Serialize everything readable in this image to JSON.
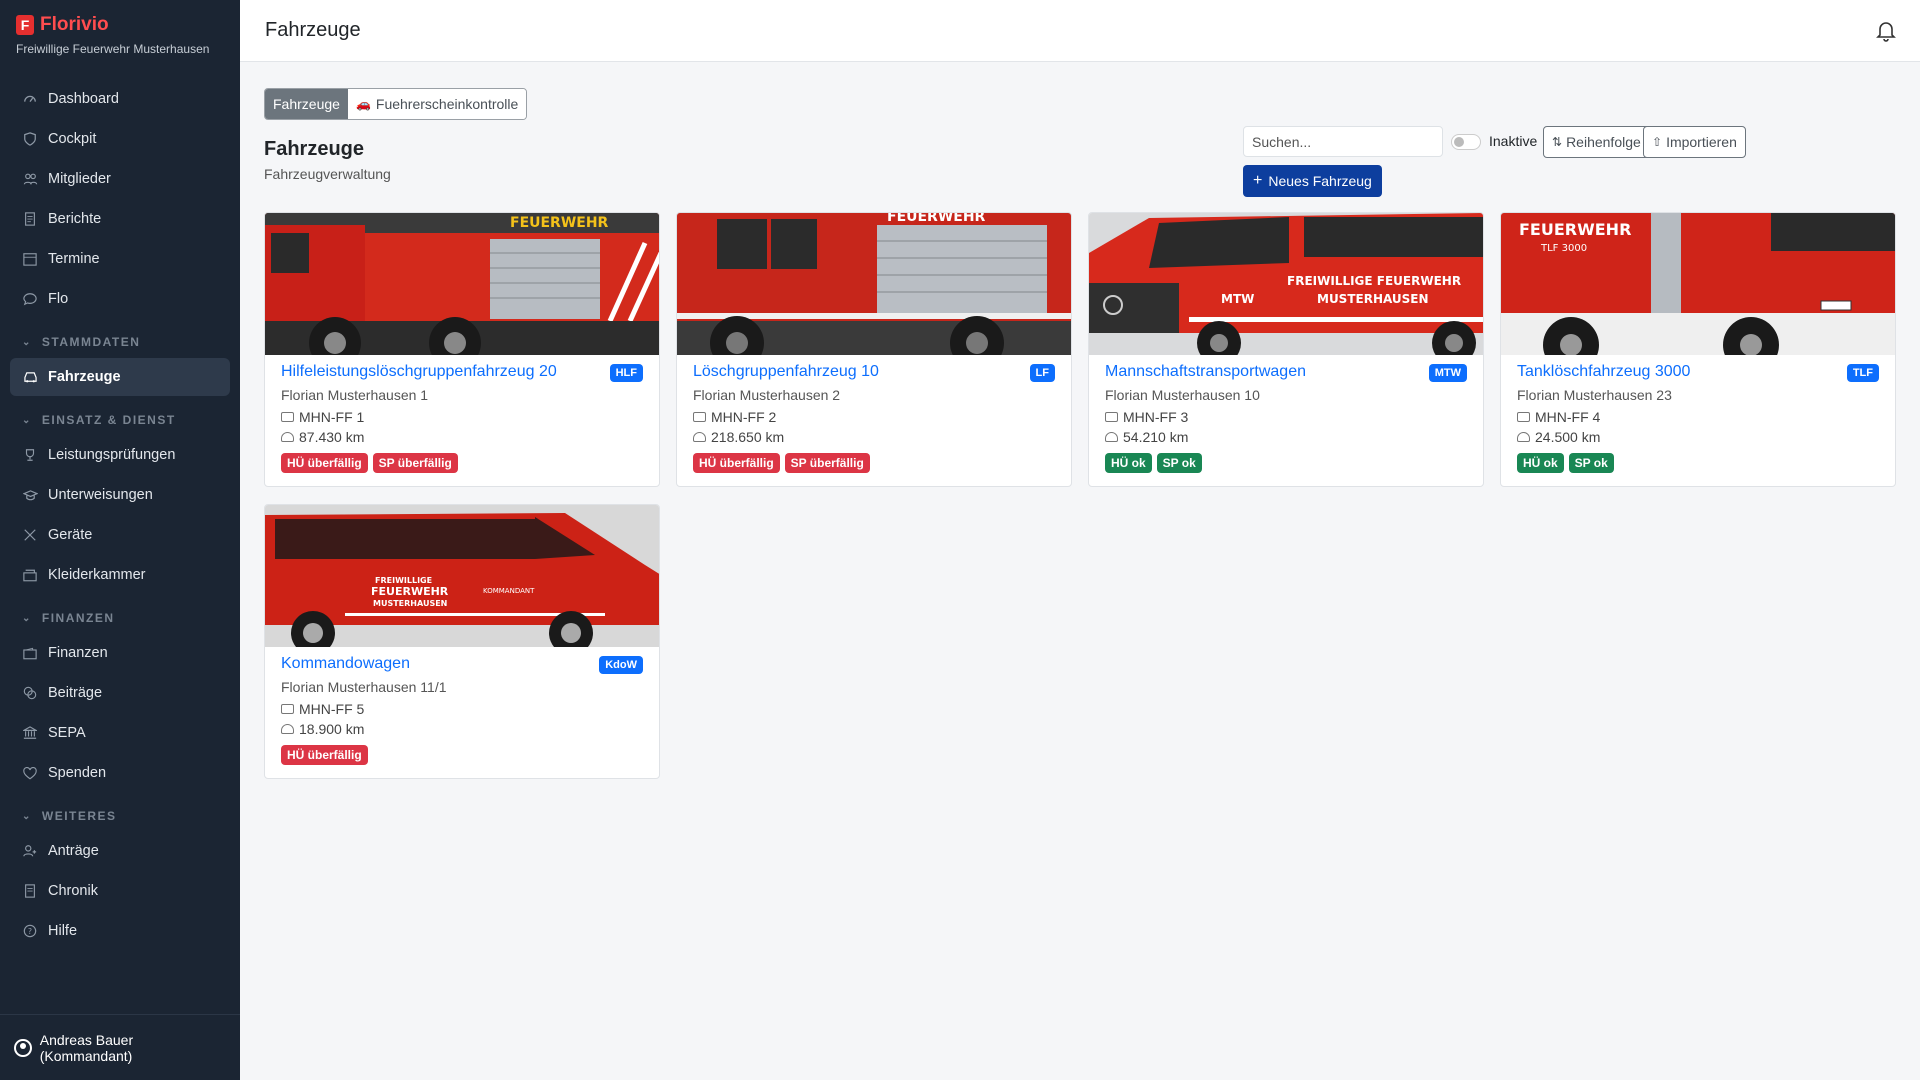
{
  "brand": {
    "logo_letter": "F",
    "name": "Florivio",
    "subtitle": "Freiwillige Feuerwehr Musterhausen"
  },
  "nav": {
    "items_top": [
      {
        "label": "Dashboard",
        "icon": "speedometer-icon"
      },
      {
        "label": "Cockpit",
        "icon": "shield-icon"
      },
      {
        "label": "Mitglieder",
        "icon": "people-icon"
      },
      {
        "label": "Berichte",
        "icon": "document-icon"
      },
      {
        "label": "Termine",
        "icon": "calendar-icon"
      },
      {
        "label": "Flo",
        "icon": "chat-icon"
      }
    ],
    "section_stammdaten": "STAMMDATEN",
    "item_fahrzeuge": "Fahrzeuge",
    "section_einsatz": "EINSATZ & DIENST",
    "items_einsatz": [
      {
        "label": "Leistungsprüfungen",
        "icon": "trophy-icon"
      },
      {
        "label": "Unterweisungen",
        "icon": "mortarboard-icon"
      },
      {
        "label": "Geräte",
        "icon": "tools-icon"
      },
      {
        "label": "Kleiderkammer",
        "icon": "box-icon"
      }
    ],
    "section_finanzen": "FINANZEN",
    "items_finanzen": [
      {
        "label": "Finanzen",
        "icon": "wallet-icon"
      },
      {
        "label": "Beiträge",
        "icon": "coins-icon"
      },
      {
        "label": "SEPA",
        "icon": "bank-icon"
      },
      {
        "label": "Spenden",
        "icon": "heart-icon"
      }
    ],
    "section_weiteres": "WEITERES",
    "items_weiteres": [
      {
        "label": "Anträge",
        "icon": "person-add-icon"
      },
      {
        "label": "Chronik",
        "icon": "book-icon"
      },
      {
        "label": "Hilfe",
        "icon": "question-icon"
      }
    ]
  },
  "user": {
    "name": "Andreas Bauer (Kommandant)"
  },
  "topbar": {
    "title": "Fahrzeuge"
  },
  "tabs": {
    "fahrzeuge": "Fahrzeuge",
    "fuehrerschein": "Fuehrerscheinkontrolle"
  },
  "page": {
    "title": "Fahrzeuge",
    "subtitle": "Fahrzeugverwaltung"
  },
  "toolbar": {
    "search_placeholder": "Suchen...",
    "inactive_label": "Inaktive",
    "order_label": "Reihenfolge",
    "import_label": "Importieren",
    "new_label": "Neues Fahrzeug"
  },
  "vehicles": [
    {
      "name": "Hilfeleistungslöschgruppenfahrzeug 20",
      "badge": "HLF",
      "callsign": "Florian Musterhausen 1",
      "plate": "MHN-FF 1",
      "mileage": "87.430 km",
      "tags": [
        {
          "label": "HÜ überfällig",
          "status": "red"
        },
        {
          "label": "SP überfällig",
          "status": "red"
        }
      ]
    },
    {
      "name": "Löschgruppenfahrzeug 10",
      "badge": "LF",
      "callsign": "Florian Musterhausen 2",
      "plate": "MHN-FF 2",
      "mileage": "218.650 km",
      "tags": [
        {
          "label": "HÜ überfällig",
          "status": "red"
        },
        {
          "label": "SP überfällig",
          "status": "red"
        }
      ]
    },
    {
      "name": "Mannschaftstransportwagen",
      "badge": "MTW",
      "callsign": "Florian Musterhausen 10",
      "plate": "MHN-FF 3",
      "mileage": "54.210 km",
      "tags": [
        {
          "label": "HÜ ok",
          "status": "green"
        },
        {
          "label": "SP ok",
          "status": "green"
        }
      ]
    },
    {
      "name": "Tanklöschfahrzeug 3000",
      "badge": "TLF",
      "callsign": "Florian Musterhausen 23",
      "plate": "MHN-FF 4",
      "mileage": "24.500 km",
      "tags": [
        {
          "label": "HÜ ok",
          "status": "green"
        },
        {
          "label": "SP ok",
          "status": "green"
        }
      ]
    },
    {
      "name": "Kommandowagen",
      "badge": "KdoW",
      "callsign": "Florian Musterhausen 11/1",
      "plate": "MHN-FF 5",
      "mileage": "18.900 km",
      "tags": [
        {
          "label": "HÜ überfällig",
          "status": "red"
        }
      ]
    }
  ],
  "photo_text": {
    "hlf": "FEUERWEHR",
    "lf": "FEUERWEHR",
    "mtw_1": "FREIWILLIGE FEUERWEHR",
    "mtw_2": "MUSTERHAUSEN",
    "mtw_side": "MTW",
    "tlf_1": "FEUERWEHR",
    "tlf_2": "TLF 3000",
    "kdow_1": "FREIWILLIGE",
    "kdow_2": "FEUERWEHR",
    "kdow_3": "MUSTERHAUSEN",
    "kdow_4": "KOMMANDANT"
  },
  "colors": {
    "sidebar_bg": "#1b2533",
    "accent": "#0d6efd",
    "primary_button": "#0d3e9e",
    "danger": "#dc3545",
    "success": "#198754",
    "brand_red": "#ff4d4f"
  }
}
